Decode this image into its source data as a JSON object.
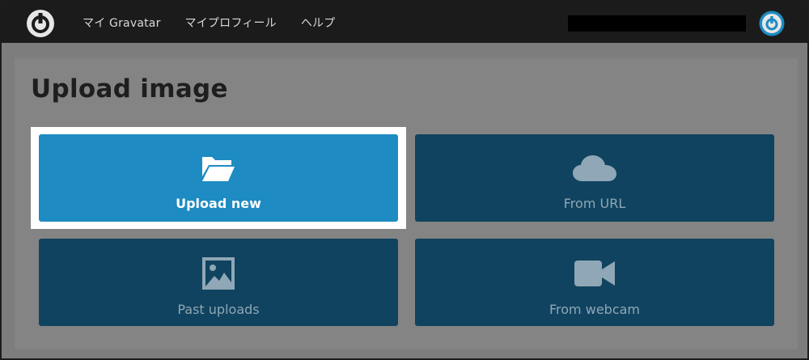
{
  "nav": {
    "items": [
      {
        "label": "マイ Gravatar"
      },
      {
        "label": "マイプロフィール"
      },
      {
        "label": "ヘルプ"
      }
    ]
  },
  "page": {
    "title": "Upload image"
  },
  "tiles": {
    "upload_new": {
      "label": "Upload new",
      "icon": "folder-open-icon",
      "active": true
    },
    "from_url": {
      "label": "From URL",
      "icon": "cloud-icon"
    },
    "past_uploads": {
      "label": "Past uploads",
      "icon": "image-icon"
    },
    "from_webcam": {
      "label": "From webcam",
      "icon": "video-camera-icon"
    }
  },
  "colors": {
    "active_tile": "#1e8bc2",
    "tile": "#10435f",
    "topbar": "#1b1b1b",
    "accent": "#1e8bc2"
  }
}
